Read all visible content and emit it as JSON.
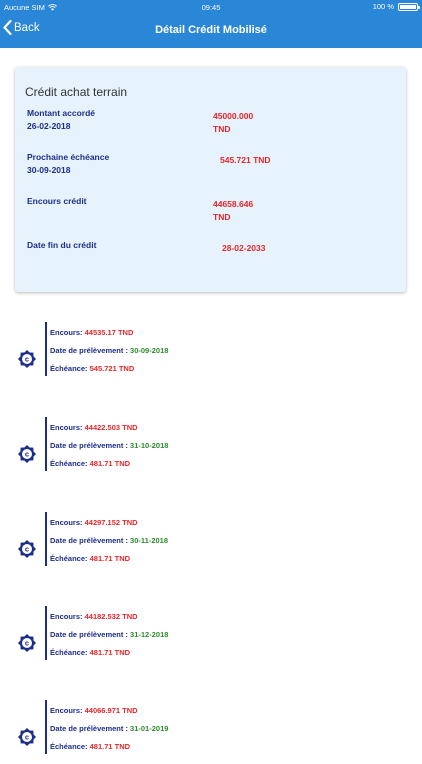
{
  "status": {
    "carrier": "Aucune SIM",
    "time": "09:45",
    "battery": "100 %"
  },
  "nav": {
    "back_label": "Back",
    "title": "Détail Crédit Mobilisé"
  },
  "credit": {
    "title": "Crédit achat terrain",
    "fields": [
      {
        "label": "Montant accordé",
        "sub": "26-02-2018",
        "value": "45000.000",
        "value2": "TND"
      },
      {
        "label": "Prochaine échéance",
        "sub": "30-09-2018",
        "value": "545.721 TND",
        "value2": ""
      },
      {
        "label": "Encours crédit",
        "sub": "",
        "value": "44658.646",
        "value2": "TND"
      },
      {
        "label": "Date fin du crédit",
        "sub": "",
        "value": "28-02-2033",
        "value2": ""
      }
    ]
  },
  "timeline": {
    "labels": {
      "encours": "Encours:",
      "date": "Date de prélèvement :",
      "echeance": "Échéance:"
    },
    "icon_letter": "c",
    "items": [
      {
        "encours": "44535.17 TND",
        "date": "30-09-2018",
        "echeance": "545.721 TND"
      },
      {
        "encours": "44422.503 TND",
        "date": "31-10-2018",
        "echeance": "481.71 TND"
      },
      {
        "encours": "44297.152 TND",
        "date": "30-11-2018",
        "echeance": "481.71 TND"
      },
      {
        "encours": "44182.532 TND",
        "date": "31-12-2018",
        "echeance": "481.71 TND"
      },
      {
        "encours": "44066.971 TND",
        "date": "31-01-2019",
        "echeance": "481.71 TND"
      }
    ]
  },
  "colors": {
    "primary": "#2a86d6",
    "card_bg": "#e6f3fd",
    "navy": "#1e2d8a",
    "red": "#e8262a",
    "green": "#2e8b2e"
  }
}
